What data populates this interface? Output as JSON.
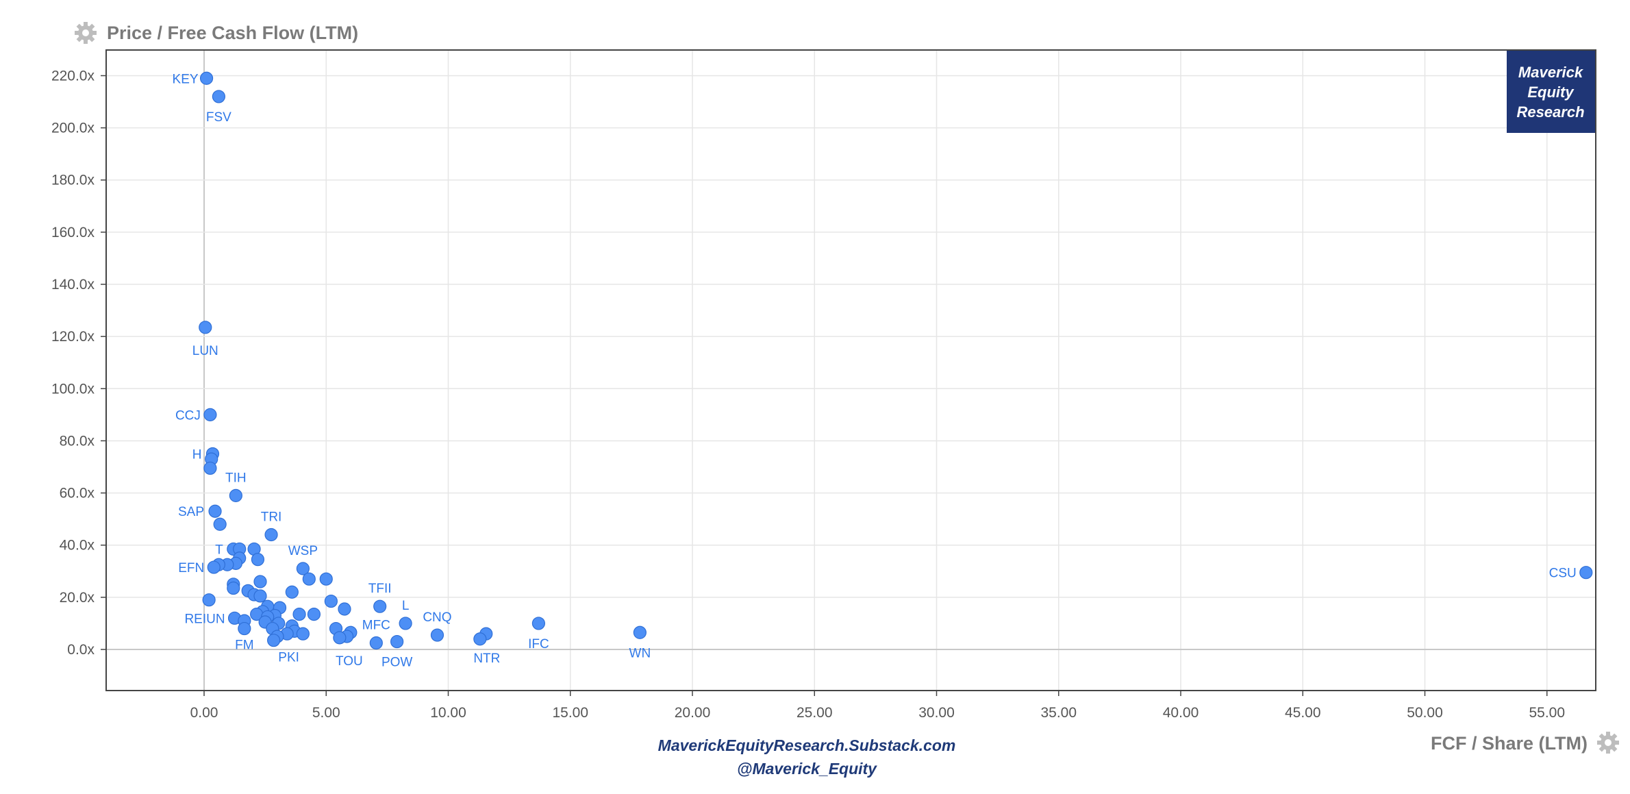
{
  "chart_data": {
    "type": "scatter",
    "title": "Price / Free Cash Flow (LTM)",
    "xlabel": "FCF / Share (LTM)",
    "ylabel": "Price / Free Cash Flow (LTM)",
    "xlim": [
      -4,
      57
    ],
    "ylim": [
      -16,
      230
    ],
    "x_ticks": [
      "0.00",
      "5.00",
      "10.00",
      "15.00",
      "20.00",
      "25.00",
      "30.00",
      "35.00",
      "40.00",
      "45.00",
      "50.00",
      "55.00"
    ],
    "y_ticks": [
      "0.0x",
      "20.0x",
      "40.0x",
      "60.0x",
      "80.0x",
      "100.0x",
      "120.0x",
      "140.0x",
      "160.0x",
      "180.0x",
      "200.0x",
      "220.0x"
    ],
    "grid": true,
    "point_color": "#4d8ff5",
    "points": [
      {
        "label": "KEY",
        "x": 0.1,
        "y": 219
      },
      {
        "label": "FSV",
        "x": 0.6,
        "y": 212
      },
      {
        "label": "LUN",
        "x": 0.05,
        "y": 123.5
      },
      {
        "label": "CCJ",
        "x": 0.25,
        "y": 90
      },
      {
        "label": "H",
        "x": 0.35,
        "y": 75
      },
      {
        "label": "",
        "x": 0.3,
        "y": 73
      },
      {
        "label": "",
        "x": 0.25,
        "y": 69.5
      },
      {
        "label": "TIH",
        "x": 1.3,
        "y": 59
      },
      {
        "label": "SAP",
        "x": 0.45,
        "y": 53
      },
      {
        "label": "",
        "x": 0.65,
        "y": 48
      },
      {
        "label": "TRI",
        "x": 2.75,
        "y": 44
      },
      {
        "label": "T",
        "x": 1.2,
        "y": 38.5
      },
      {
        "label": "",
        "x": 1.45,
        "y": 38.5
      },
      {
        "label": "",
        "x": 2.05,
        "y": 38.5
      },
      {
        "label": "",
        "x": 1.45,
        "y": 35
      },
      {
        "label": "",
        "x": 2.2,
        "y": 34.5
      },
      {
        "label": "",
        "x": 1.3,
        "y": 33
      },
      {
        "label": "",
        "x": 0.95,
        "y": 32.5
      },
      {
        "label": "",
        "x": 0.6,
        "y": 32.5
      },
      {
        "label": "EFN",
        "x": 0.4,
        "y": 31.5
      },
      {
        "label": "WSP",
        "x": 4.05,
        "y": 31
      },
      {
        "label": "",
        "x": 4.3,
        "y": 27
      },
      {
        "label": "",
        "x": 5.0,
        "y": 27
      },
      {
        "label": "",
        "x": 2.3,
        "y": 26
      },
      {
        "label": "",
        "x": 1.2,
        "y": 25
      },
      {
        "label": "",
        "x": 1.2,
        "y": 23.5
      },
      {
        "label": "",
        "x": 1.8,
        "y": 22.5
      },
      {
        "label": "",
        "x": 3.6,
        "y": 22
      },
      {
        "label": "",
        "x": 2.05,
        "y": 21
      },
      {
        "label": "",
        "x": 2.3,
        "y": 20.5
      },
      {
        "label": "",
        "x": 0.2,
        "y": 19
      },
      {
        "label": "",
        "x": 5.2,
        "y": 18.5
      },
      {
        "label": "TFII",
        "x": 7.2,
        "y": 16.5
      },
      {
        "label": "",
        "x": 2.6,
        "y": 16.5
      },
      {
        "label": "",
        "x": 3.1,
        "y": 16
      },
      {
        "label": "",
        "x": 5.75,
        "y": 15.5
      },
      {
        "label": "",
        "x": 2.4,
        "y": 14.5
      },
      {
        "label": "",
        "x": 2.15,
        "y": 13.5
      },
      {
        "label": "",
        "x": 3.9,
        "y": 13.5
      },
      {
        "label": "",
        "x": 4.5,
        "y": 13.5
      },
      {
        "label": "",
        "x": 2.9,
        "y": 13
      },
      {
        "label": "",
        "x": 2.6,
        "y": 12.5
      },
      {
        "label": "REIUN",
        "x": 1.25,
        "y": 12
      },
      {
        "label": "",
        "x": 1.65,
        "y": 11
      },
      {
        "label": "",
        "x": 2.5,
        "y": 10.5
      },
      {
        "label": "",
        "x": 3.05,
        "y": 10
      },
      {
        "label": "L",
        "x": 8.25,
        "y": 10
      },
      {
        "label": "IFC",
        "x": 13.7,
        "y": 10
      },
      {
        "label": "",
        "x": 3.6,
        "y": 9
      },
      {
        "label": "",
        "x": 2.8,
        "y": 8
      },
      {
        "label": "FM",
        "x": 1.65,
        "y": 8
      },
      {
        "label": "",
        "x": 5.4,
        "y": 8
      },
      {
        "label": "",
        "x": 3.7,
        "y": 7
      },
      {
        "label": "WN",
        "x": 17.85,
        "y": 6.5
      },
      {
        "label": "",
        "x": 6.0,
        "y": 6.5
      },
      {
        "label": "",
        "x": 3.4,
        "y": 6
      },
      {
        "label": "",
        "x": 4.05,
        "y": 6
      },
      {
        "label": "",
        "x": 11.55,
        "y": 6
      },
      {
        "label": "CNQ",
        "x": 9.55,
        "y": 5.5
      },
      {
        "label": "",
        "x": 3.0,
        "y": 5
      },
      {
        "label": "",
        "x": 5.85,
        "y": 5
      },
      {
        "label": "TOU",
        "x": 5.55,
        "y": 4.5
      },
      {
        "label": "NTR",
        "x": 11.3,
        "y": 4
      },
      {
        "label": "PKI",
        "x": 2.85,
        "y": 3.5
      },
      {
        "label": "POW",
        "x": 7.9,
        "y": 3
      },
      {
        "label": "MFC",
        "x": 7.05,
        "y": 2.5
      },
      {
        "label": "CSU",
        "x": 56.6,
        "y": 29.5
      }
    ]
  },
  "credits": {
    "line1": "MaverickEquityResearch.Substack.com",
    "line2": "@Maverick_Equity"
  },
  "brand": {
    "line1": "Maverick",
    "line2": "Equity",
    "line3": "Research",
    "bg_color": "#1f3676"
  },
  "icons": {
    "title_icon": "gear-icon",
    "xlabel_icon": "gear-icon"
  }
}
